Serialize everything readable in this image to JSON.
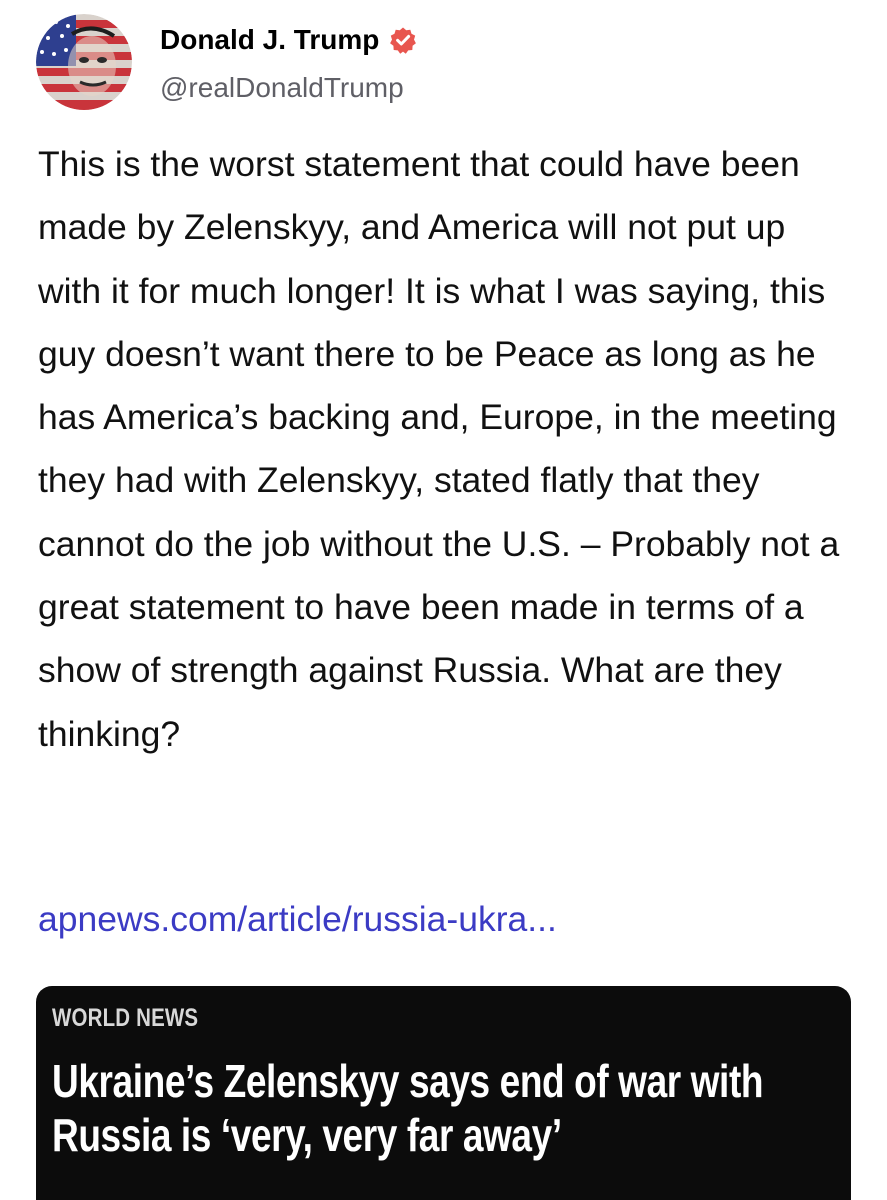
{
  "author": {
    "display_name": "Donald J. Trump",
    "handle": "@realDonaldTrump",
    "verified": true,
    "verified_badge_color": "#e8564f"
  },
  "post": {
    "text": "This is the worst statement that could have been made by Zelenskyy, and America will not put up with it for much longer! It is what I was saying, this guy doesn’t want there to be Peace as long as he has America’s backing and, Europe, in the meeting they had with Zelenskyy, stated flatly that they cannot do the job without the U.S. – Probably not a great statement to have been made in terms of a show of strength against Russia. What are they thinking?",
    "link_text": "apnews.com/article/russia-ukra...",
    "link_color": "#3b3bc4"
  },
  "link_card": {
    "section": "WORLD NEWS",
    "headline": "Ukraine’s Zelenskyy says end of war with Russia is ‘very, very far away’",
    "background": "#0c0c0c"
  },
  "icons": {
    "avatar": "avatar-flag-portrait",
    "verified": "verified-badge-icon"
  }
}
